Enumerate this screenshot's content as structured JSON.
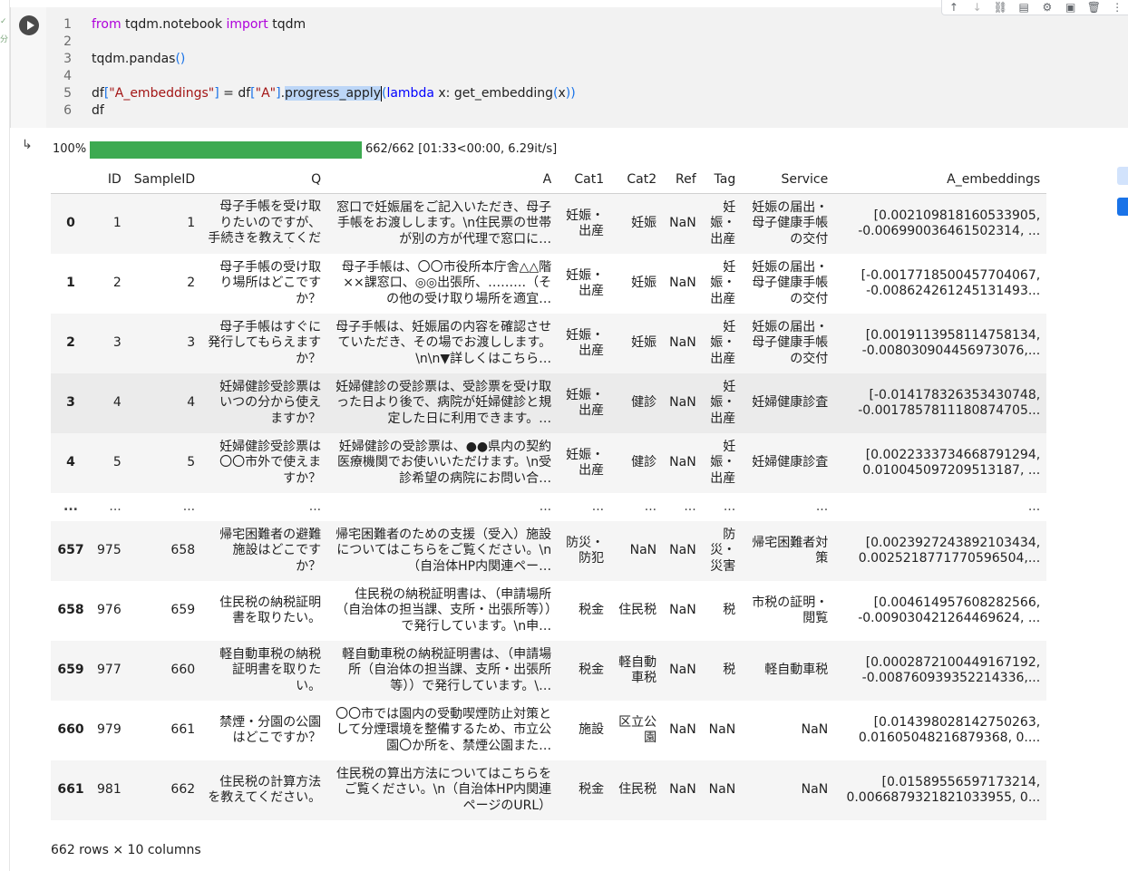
{
  "gutter_marks": [
    "✓",
    "分"
  ],
  "code": {
    "lines": [
      {
        "n": "1",
        "parts": [
          {
            "t": "from",
            "c": "kw"
          },
          {
            "t": " tqdm.notebook ",
            "c": "fn"
          },
          {
            "t": "import",
            "c": "kw"
          },
          {
            "t": " tqdm",
            "c": "fn"
          }
        ]
      },
      {
        "n": "2",
        "parts": []
      },
      {
        "n": "3",
        "parts": [
          {
            "t": "tqdm.pandas",
            "c": "fn"
          },
          {
            "t": "()",
            "c": "par"
          }
        ]
      },
      {
        "n": "4",
        "parts": []
      },
      {
        "n": "5",
        "parts": [
          {
            "t": "df",
            "c": "fn"
          },
          {
            "t": "[",
            "c": "par"
          },
          {
            "t": "\"A_embeddings\"",
            "c": "str"
          },
          {
            "t": "]",
            "c": "par"
          },
          {
            "t": " = df",
            "c": "fn"
          },
          {
            "t": "[",
            "c": "par"
          },
          {
            "t": "\"A\"",
            "c": "str"
          },
          {
            "t": "]",
            "c": "par"
          },
          {
            "t": ".",
            "c": "fn"
          },
          {
            "t": "progress_apply",
            "c": "sel"
          },
          {
            "t": "CARET",
            "c": "caret"
          },
          {
            "t": "(",
            "c": "par"
          },
          {
            "t": "lambda",
            "c": "kwl"
          },
          {
            "t": " x: get_embedding",
            "c": "fn"
          },
          {
            "t": "(",
            "c": "par"
          },
          {
            "t": "x",
            "c": "fn"
          },
          {
            "t": "))",
            "c": "par"
          }
        ]
      },
      {
        "n": "6",
        "parts": [
          {
            "t": "df",
            "c": "fn"
          }
        ]
      }
    ]
  },
  "toolbar": {
    "icons": [
      "arrow-up-icon",
      "arrow-down-icon",
      "link-icon",
      "comment-icon",
      "gear-icon",
      "mirror-cell-icon",
      "delete-icon",
      "more-icon"
    ],
    "glyphs": [
      "↑",
      "↓",
      "⛓",
      "▤",
      "⚙",
      "▣",
      "🗑",
      "⋮"
    ]
  },
  "output_icon": "↳",
  "progress": {
    "percent_label": "100%",
    "fraction": 1.0,
    "text": "662/662 [01:33<00:00, 6.29it/s]"
  },
  "table": {
    "columns": [
      "",
      "ID",
      "SampleID",
      "Q",
      "A",
      "Cat1",
      "Cat2",
      "Ref",
      "Tag",
      "Service",
      "A_embeddings"
    ],
    "rows": [
      {
        "idx": "0",
        "id": "1",
        "sample": "1",
        "q": "母子手帳を受け取りたいのですが、手続きを教えてください。",
        "a": "窓口で妊娠届をご記入いただき、母子手帳をお渡しします。\\n住民票の世帯が別の方が代理で窓口に…",
        "cat1": "妊娠・出産",
        "cat2": "妊娠",
        "ref": "NaN",
        "tag": "妊娠・出産",
        "svc": "妊娠の届出・母子健康手帳の交付",
        "emb": "[0.002109818160533905, -0.006990036461502314, ..."
      },
      {
        "idx": "1",
        "id": "2",
        "sample": "2",
        "q": "母子手帳の受け取り場所はどこですか？",
        "a": "母子手帳は、〇〇市役所本庁舎△△階××課窓口、◎◎出張所、………（その他の受け取り場所を適宜…",
        "cat1": "妊娠・出産",
        "cat2": "妊娠",
        "ref": "NaN",
        "tag": "妊娠・出産",
        "svc": "妊娠の届出・母子健康手帳の交付",
        "emb": "[-0.0017718500457704067, -0.008624261245131493..."
      },
      {
        "idx": "2",
        "id": "3",
        "sample": "3",
        "q": "母子手帳はすぐに発行してもらえますか？",
        "a": "母子手帳は、妊娠届の内容を確認させていただき、その場でお渡しします。\\n\\n▼詳しくはこちら…",
        "cat1": "妊娠・出産",
        "cat2": "妊娠",
        "ref": "NaN",
        "tag": "妊娠・出産",
        "svc": "妊娠の届出・母子健康手帳の交付",
        "emb": "[0.0019113958114758134, -0.008030904456973076,..."
      },
      {
        "idx": "3",
        "id": "4",
        "sample": "4",
        "q": "妊婦健診受診票はいつの分から使えますか？",
        "a": "妊婦健診の受診票は、受診票を受け取った日より後で、病院が妊婦健診と規定した日に利用できます。…",
        "cat1": "妊娠・出産",
        "cat2": "健診",
        "ref": "NaN",
        "tag": "妊娠・出産",
        "svc": "妊婦健康診査",
        "emb": "[-0.014178326353430748, -0.0017857811180874705..."
      },
      {
        "idx": "4",
        "id": "5",
        "sample": "5",
        "q": "妊婦健診受診票は〇〇市外で使えますか？",
        "a": "妊婦健診の受診票は、●●県内の契約医療機関でお使いいただけます。\\n受診希望の病院にお問い合…",
        "cat1": "妊娠・出産",
        "cat2": "健診",
        "ref": "NaN",
        "tag": "妊娠・出産",
        "svc": "妊婦健康診査",
        "emb": "[0.0022333734668791294, 0.010045097209513187, ..."
      },
      {
        "idx": "...",
        "id": "...",
        "sample": "...",
        "q": "...",
        "a": "...",
        "cat1": "...",
        "cat2": "...",
        "ref": "...",
        "tag": "...",
        "svc": "...",
        "emb": "...",
        "ellipsis": true
      },
      {
        "idx": "657",
        "id": "975",
        "sample": "658",
        "q": "帰宅困難者の避難施設はどこですか？",
        "a": "帰宅困難者のための支援（受入）施設についてはこちらをご覧ください。\\n（自治体HP内関連ペー…",
        "cat1": "防災・防犯",
        "cat2": "NaN",
        "ref": "NaN",
        "tag": "防災・災害",
        "svc": "帰宅困難者対策",
        "emb": "[0.0023927243892103434, 0.0025218771770596504,..."
      },
      {
        "idx": "658",
        "id": "976",
        "sample": "659",
        "q": "住民税の納税証明書を取りたい。",
        "a": "住民税の納税証明書は、（申請場所（自治体の担当課、支所・出張所等））で発行しています。\\n申…",
        "cat1": "税金",
        "cat2": "住民税",
        "ref": "NaN",
        "tag": "税",
        "svc": "市税の証明・閲覧",
        "emb": "[0.004614957608282566, -0.009030421264469624, ..."
      },
      {
        "idx": "659",
        "id": "977",
        "sample": "660",
        "q": "軽自動車税の納税証明書を取りたい。",
        "a": "軽自動車税の納税証明書は、（申請場所（自治体の担当課、支所・出張所等））で発行しています。\\…",
        "cat1": "税金",
        "cat2": "軽自動車税",
        "ref": "NaN",
        "tag": "税",
        "svc": "軽自動車税",
        "emb": "[0.0002872100449167192, -0.008760939352214336,..."
      },
      {
        "idx": "660",
        "id": "979",
        "sample": "661",
        "q": "禁煙・分園の公園はどこですか？",
        "a": "〇〇市では園内の受動喫煙防止対策として分煙環境を整備するため、市立公園〇か所を、禁煙公園また…",
        "cat1": "施設",
        "cat2": "区立公園",
        "ref": "NaN",
        "tag": "NaN",
        "svc": "NaN",
        "emb": "[0.014398028142750263, 0.01605048216879368, 0...."
      },
      {
        "idx": "661",
        "id": "981",
        "sample": "662",
        "q": "住民税の計算方法を教えてください。",
        "a": "住民税の算出方法についてはこちらをご覧ください。\\n（自治体HP内関連ページのURL）",
        "cat1": "税金",
        "cat2": "住民税",
        "ref": "NaN",
        "tag": "NaN",
        "svc": "NaN",
        "emb": "[0.01589556597173214, 0.0066879321821033955, 0..."
      }
    ],
    "footer": "662 rows × 10 columns"
  },
  "colors": {
    "progress": "#3daa51",
    "accent_blue": "#1a73e8"
  }
}
